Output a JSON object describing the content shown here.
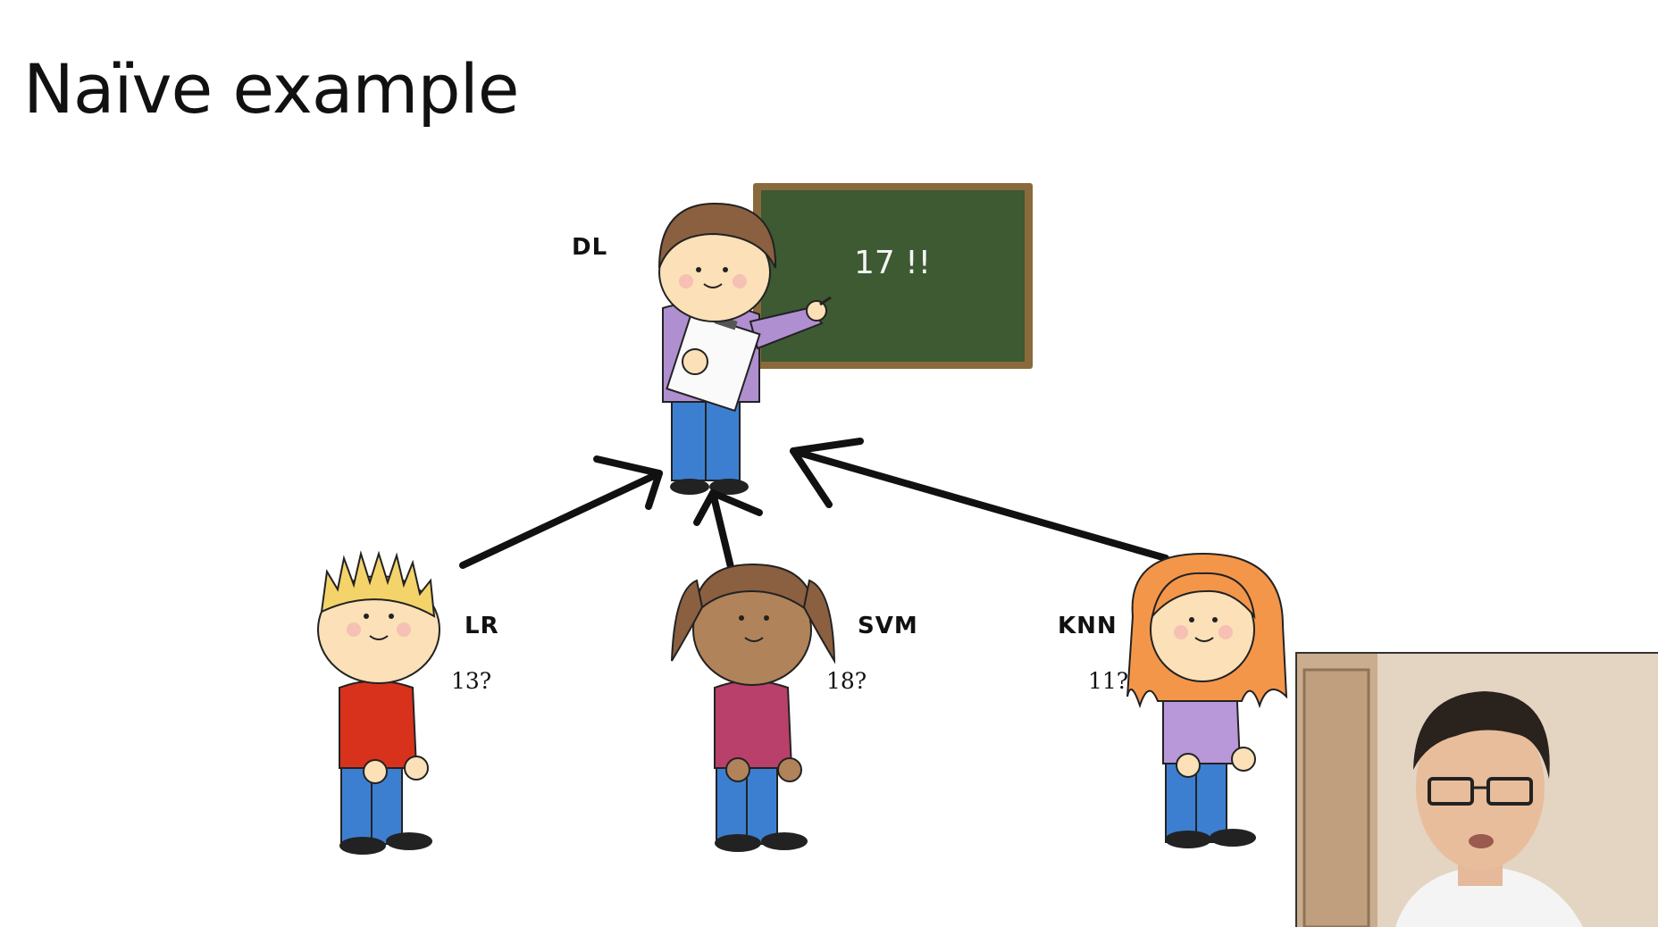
{
  "slide": {
    "title": "Naïve example",
    "teacher": {
      "label": "DL",
      "board_text": "17 !!"
    },
    "students": [
      {
        "label": "LR",
        "guess": "13?"
      },
      {
        "label": "SVM",
        "guess": "18?"
      },
      {
        "label": "KNN",
        "guess": "11?"
      }
    ]
  },
  "colors": {
    "chalkboard": "#3d5a32",
    "frame": "#8a6a3c",
    "teacher_shirt": "#b08fd0",
    "lr_shirt": "#d8321c",
    "svm_shirt": "#b8406a",
    "knn_shirt": "#b898d8",
    "jeans": "#3c7fd0"
  }
}
